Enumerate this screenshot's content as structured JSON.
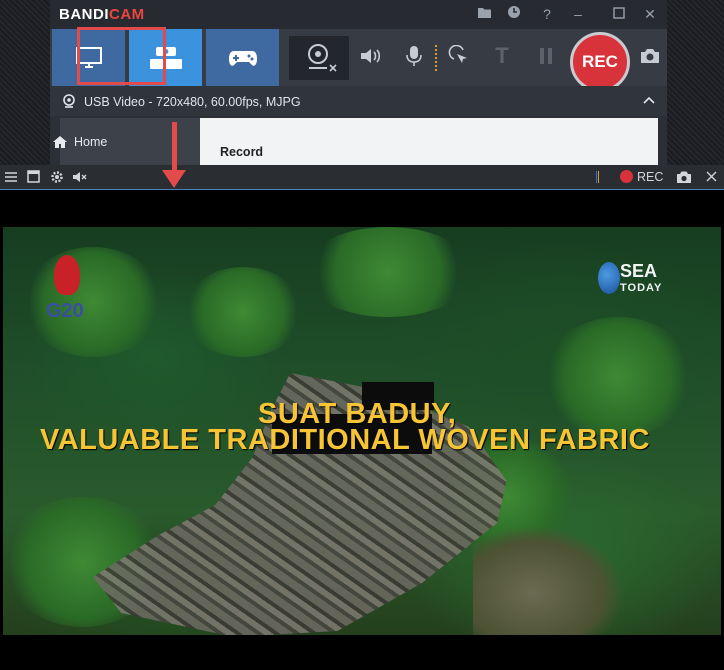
{
  "app": {
    "logo_main": "BANDI",
    "logo_accent": "CAM"
  },
  "toolbar": {
    "modes": [
      {
        "name": "screen",
        "icon": "monitor-icon"
      },
      {
        "name": "device",
        "icon": "hdmi-icon",
        "label": "HDMI",
        "active": true
      },
      {
        "name": "game",
        "icon": "gamepad-icon"
      }
    ],
    "rec_label": "REC"
  },
  "device_info": {
    "text": "USB Video - 720x480, 60.00fps, MJPG"
  },
  "sidebar": {
    "home_label": "Home"
  },
  "main": {
    "section_label": "Record"
  },
  "preview": {
    "rec_label": "REC"
  },
  "video": {
    "caption_line1": "SUAT BADUY,",
    "caption_line2": "VALUABLE TRADITIONAL WOVEN FABRIC",
    "logo_left": "G20",
    "logo_right_top": "SEA",
    "logo_right_bottom": "TODAY"
  },
  "colors": {
    "accent_blue": "#3b92dd",
    "rec_red": "#d8323a",
    "highlight": "#e34b4b",
    "caption_yellow": "#f6c435"
  }
}
